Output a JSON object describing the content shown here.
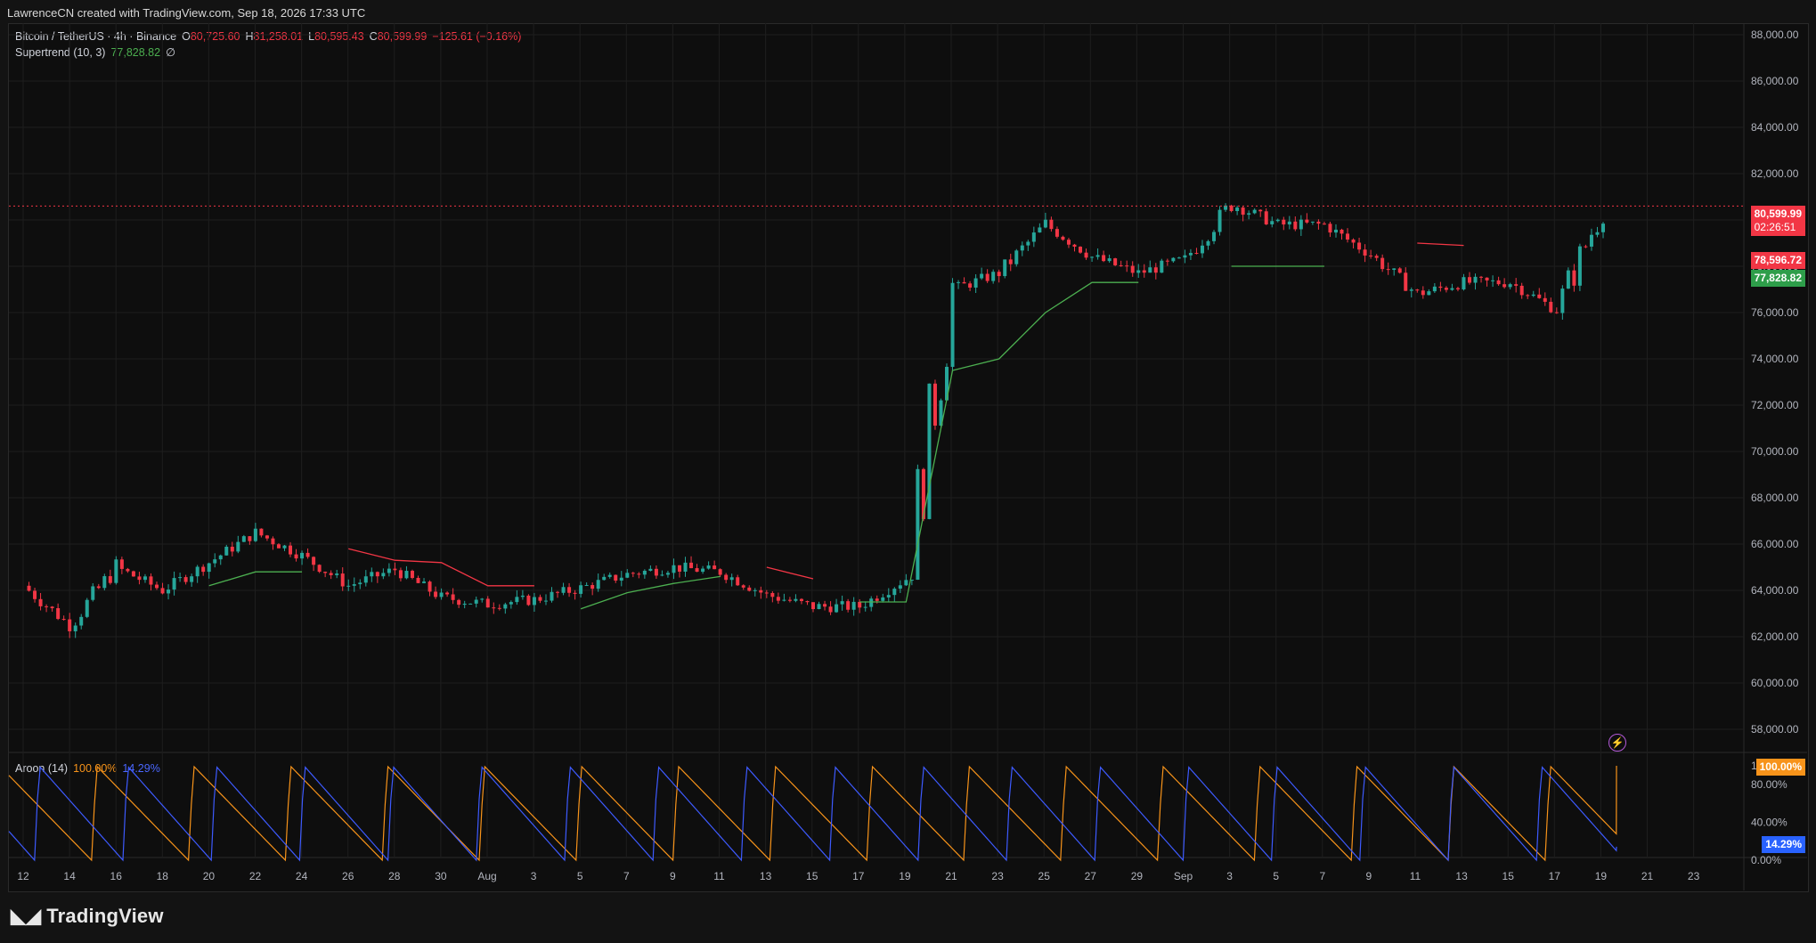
{
  "header": {
    "creator_line": "LawrenceCN created with TradingView.com, Sep 18, 2026 17:33 UTC"
  },
  "legend": {
    "symbol": "Bitcoin / TetherUS · 4h · Binance",
    "open_label": "O",
    "open": "80,725.60",
    "high_label": "H",
    "high": "81,258.01",
    "low_label": "L",
    "low": "80,595.43",
    "close_label": "C",
    "close": "80,599.99",
    "change": "−125.61 (−0.16%)",
    "supertrend_label": "Supertrend (10, 3)",
    "supertrend_value": "77,828.82",
    "supertrend_icon": "∅"
  },
  "aroon_legend": {
    "label": "Aroon (14)",
    "up": "100.00%",
    "down": "14.29%"
  },
  "price_labels": {
    "last_price": "80,599.99",
    "countdown": "02:26:51",
    "supertrend_down": "78,596.72",
    "supertrend_up": "77,828.82",
    "aroon_up": "100.00%",
    "aroon_down": "14.29%"
  },
  "brand": {
    "name": "TradingView",
    "logo_glyph": "17"
  },
  "colors": {
    "up": "#26a69a",
    "down": "#f23645",
    "st_up": "#4caf50",
    "st_down": "#f23645",
    "aroon_up": "#f7931a",
    "aroon_down": "#3d5afe",
    "grid": "#1e1e1e"
  },
  "chart_data": [
    {
      "type": "candlestick",
      "title": "Bitcoin / TetherUS · 4h · Binance",
      "y_ticks": [
        "88,000.00",
        "86,000.00",
        "84,000.00",
        "82,000.00",
        "80,000.00",
        "78,000.00",
        "76,000.00",
        "74,000.00",
        "72,000.00",
        "70,000.00",
        "68,000.00",
        "66,000.00",
        "64,000.00",
        "62,000.00",
        "60,000.00",
        "58,000.00"
      ],
      "ylim": [
        57000,
        88500
      ],
      "x_ticks": [
        "12",
        "14",
        "16",
        "18",
        "20",
        "22",
        "24",
        "26",
        "28",
        "30",
        "Aug",
        "3",
        "5",
        "7",
        "9",
        "11",
        "13",
        "15",
        "17",
        "19",
        "21",
        "23",
        "25",
        "27",
        "29",
        "Sep",
        "3",
        "5",
        "7",
        "9",
        "11",
        "13",
        "15",
        "17",
        "19",
        "21",
        "23"
      ],
      "x": [
        "Jul 12",
        "Jul 14",
        "Jul 16",
        "Jul 18",
        "Jul 20",
        "Jul 22",
        "Jul 24",
        "Jul 26",
        "Jul 28",
        "Jul 30",
        "Aug 1",
        "Aug 3",
        "Aug 5",
        "Aug 7",
        "Aug 9",
        "Aug 11",
        "Aug 13",
        "Aug 15",
        "Aug 17",
        "Aug 19",
        "Aug 21",
        "Aug 23",
        "Aug 25",
        "Aug 27",
        "Aug 29",
        "Sep 1",
        "Sep 3",
        "Sep 5",
        "Sep 7",
        "Sep 9",
        "Sep 11",
        "Sep 13",
        "Sep 15",
        "Sep 17",
        "Sep 18"
      ],
      "close": [
        64200,
        62500,
        65000,
        64000,
        65200,
        66500,
        65500,
        64200,
        64900,
        63700,
        63400,
        63600,
        64100,
        64700,
        65000,
        64800,
        63800,
        63300,
        63300,
        64500,
        77000,
        77700,
        79800,
        78400,
        77700,
        78300,
        80700,
        79800,
        79800,
        78500,
        76800,
        77300,
        77300,
        76100,
        80600
      ],
      "supertrend_up": [
        63000,
        null,
        63800,
        null,
        64200,
        64800,
        64800,
        null,
        null,
        null,
        null,
        null,
        63200,
        63900,
        64300,
        64600,
        null,
        null,
        63500,
        63500,
        73500,
        74000,
        76000,
        77300,
        77300,
        null,
        78000,
        78000,
        78000,
        null,
        null,
        null,
        76800,
        null,
        77828.82
      ],
      "supertrend_down": [
        null,
        65000,
        null,
        65200,
        null,
        null,
        null,
        65800,
        65300,
        65200,
        64200,
        64200,
        null,
        null,
        null,
        null,
        65000,
        64500,
        null,
        null,
        null,
        null,
        null,
        null,
        null,
        78700,
        null,
        null,
        null,
        null,
        79000,
        78900,
        null,
        78600,
        null
      ],
      "last_price": 80599.99
    },
    {
      "type": "line",
      "title": "Aroon (14)",
      "y_ticks": [
        "100.00%",
        "80.00%",
        "40.00%",
        "0.00%"
      ],
      "ylim": [
        0,
        100
      ],
      "series": [
        {
          "name": "Aroon Up",
          "last": 100.0
        },
        {
          "name": "Aroon Down",
          "last": 14.29
        }
      ]
    }
  ]
}
